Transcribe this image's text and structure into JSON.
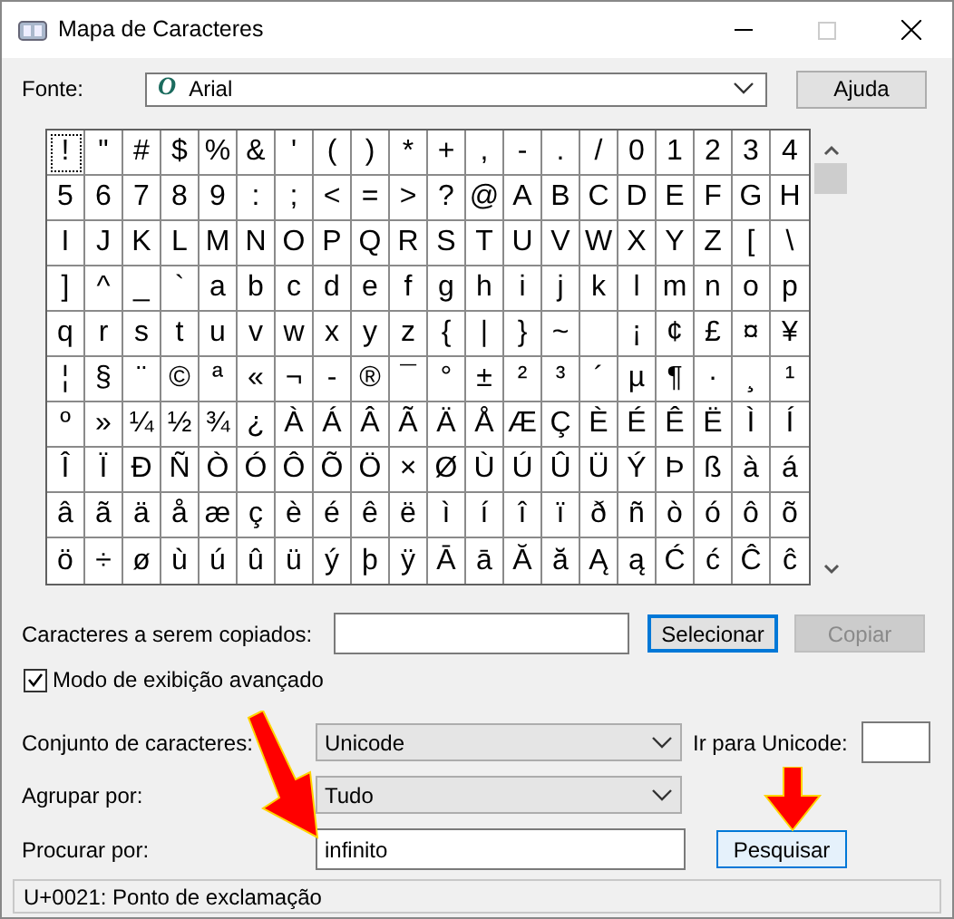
{
  "window": {
    "title": "Mapa de Caracteres"
  },
  "font": {
    "label": "Fonte:",
    "value": "Arial",
    "icon_glyph": "O"
  },
  "help_button": "Ajuda",
  "grid": [
    [
      {
        "char": "!",
        "selected": true
      },
      {
        "char": "\"",
        "selected": false
      },
      {
        "char": "#",
        "selected": false
      },
      {
        "char": "$",
        "selected": false
      },
      {
        "char": "%",
        "selected": false
      },
      {
        "char": "&",
        "selected": false
      },
      {
        "char": "'",
        "selected": false
      },
      {
        "char": "(",
        "selected": false
      },
      {
        "char": ")",
        "selected": false
      },
      {
        "char": "*",
        "selected": false
      },
      {
        "char": "+",
        "selected": false
      },
      {
        "char": ",",
        "selected": false
      },
      {
        "char": "-",
        "selected": false
      },
      {
        "char": ".",
        "selected": false
      },
      {
        "char": "/",
        "selected": false
      },
      {
        "char": "0",
        "selected": false
      },
      {
        "char": "1",
        "selected": false
      },
      {
        "char": "2",
        "selected": false
      },
      {
        "char": "3",
        "selected": false
      },
      {
        "char": "4",
        "selected": false
      }
    ],
    [
      {
        "char": "5",
        "selected": false
      },
      {
        "char": "6",
        "selected": false
      },
      {
        "char": "7",
        "selected": false
      },
      {
        "char": "8",
        "selected": false
      },
      {
        "char": "9",
        "selected": false
      },
      {
        "char": ":",
        "selected": false
      },
      {
        "char": ";",
        "selected": false
      },
      {
        "char": "<",
        "selected": false
      },
      {
        "char": "=",
        "selected": false
      },
      {
        "char": ">",
        "selected": false
      },
      {
        "char": "?",
        "selected": false
      },
      {
        "char": "@",
        "selected": false
      },
      {
        "char": "A",
        "selected": false
      },
      {
        "char": "B",
        "selected": false
      },
      {
        "char": "C",
        "selected": false
      },
      {
        "char": "D",
        "selected": false
      },
      {
        "char": "E",
        "selected": false
      },
      {
        "char": "F",
        "selected": false
      },
      {
        "char": "G",
        "selected": false
      },
      {
        "char": "H",
        "selected": false
      }
    ],
    [
      {
        "char": "I",
        "selected": false
      },
      {
        "char": "J",
        "selected": false
      },
      {
        "char": "K",
        "selected": false
      },
      {
        "char": "L",
        "selected": false
      },
      {
        "char": "M",
        "selected": false
      },
      {
        "char": "N",
        "selected": false
      },
      {
        "char": "O",
        "selected": false
      },
      {
        "char": "P",
        "selected": false
      },
      {
        "char": "Q",
        "selected": false
      },
      {
        "char": "R",
        "selected": false
      },
      {
        "char": "S",
        "selected": false
      },
      {
        "char": "T",
        "selected": false
      },
      {
        "char": "U",
        "selected": false
      },
      {
        "char": "V",
        "selected": false
      },
      {
        "char": "W",
        "selected": false
      },
      {
        "char": "X",
        "selected": false
      },
      {
        "char": "Y",
        "selected": false
      },
      {
        "char": "Z",
        "selected": false
      },
      {
        "char": "[",
        "selected": false
      },
      {
        "char": "\\",
        "selected": false
      }
    ],
    [
      {
        "char": "]",
        "selected": false
      },
      {
        "char": "^",
        "selected": false
      },
      {
        "char": "_",
        "selected": false
      },
      {
        "char": "`",
        "selected": false
      },
      {
        "char": "a",
        "selected": false
      },
      {
        "char": "b",
        "selected": false
      },
      {
        "char": "c",
        "selected": false
      },
      {
        "char": "d",
        "selected": false
      },
      {
        "char": "e",
        "selected": false
      },
      {
        "char": "f",
        "selected": false
      },
      {
        "char": "g",
        "selected": false
      },
      {
        "char": "h",
        "selected": false
      },
      {
        "char": "i",
        "selected": false
      },
      {
        "char": "j",
        "selected": false
      },
      {
        "char": "k",
        "selected": false
      },
      {
        "char": "l",
        "selected": false
      },
      {
        "char": "m",
        "selected": false
      },
      {
        "char": "n",
        "selected": false
      },
      {
        "char": "o",
        "selected": false
      },
      {
        "char": "p",
        "selected": false
      }
    ],
    [
      {
        "char": "q",
        "selected": false
      },
      {
        "char": "r",
        "selected": false
      },
      {
        "char": "s",
        "selected": false
      },
      {
        "char": "t",
        "selected": false
      },
      {
        "char": "u",
        "selected": false
      },
      {
        "char": "v",
        "selected": false
      },
      {
        "char": "w",
        "selected": false
      },
      {
        "char": "x",
        "selected": false
      },
      {
        "char": "y",
        "selected": false
      },
      {
        "char": "z",
        "selected": false
      },
      {
        "char": "{",
        "selected": false
      },
      {
        "char": "|",
        "selected": false
      },
      {
        "char": "}",
        "selected": false
      },
      {
        "char": "~",
        "selected": false
      },
      {
        "selected": false
      },
      {
        "char": "¡",
        "selected": false
      },
      {
        "char": "¢",
        "selected": false
      },
      {
        "char": "£",
        "selected": false
      },
      {
        "char": "¤",
        "selected": false
      },
      {
        "char": "¥",
        "selected": false
      }
    ],
    [
      {
        "char": "¦",
        "selected": false
      },
      {
        "char": "§",
        "selected": false
      },
      {
        "char": "¨",
        "selected": false
      },
      {
        "char": "©",
        "selected": false
      },
      {
        "char": "ª",
        "selected": false
      },
      {
        "char": "«",
        "selected": false
      },
      {
        "char": "¬",
        "selected": false
      },
      {
        "char": "-",
        "selected": false
      },
      {
        "char": "®",
        "selected": false
      },
      {
        "char": "¯",
        "selected": false
      },
      {
        "char": "°",
        "selected": false
      },
      {
        "char": "±",
        "selected": false
      },
      {
        "char": "²",
        "selected": false
      },
      {
        "char": "³",
        "selected": false
      },
      {
        "char": "´",
        "selected": false
      },
      {
        "char": "µ",
        "selected": false
      },
      {
        "char": "¶",
        "selected": false
      },
      {
        "char": "·",
        "selected": false
      },
      {
        "char": "¸",
        "selected": false
      },
      {
        "char": "¹",
        "selected": false
      }
    ],
    [
      {
        "char": "º",
        "selected": false
      },
      {
        "char": "»",
        "selected": false
      },
      {
        "char": "¼",
        "selected": false
      },
      {
        "char": "½",
        "selected": false
      },
      {
        "char": "¾",
        "selected": false
      },
      {
        "char": "¿",
        "selected": false
      },
      {
        "char": "À",
        "selected": false
      },
      {
        "char": "Á",
        "selected": false
      },
      {
        "char": "Â",
        "selected": false
      },
      {
        "char": "Ã",
        "selected": false
      },
      {
        "char": "Ä",
        "selected": false
      },
      {
        "char": "Å",
        "selected": false
      },
      {
        "char": "Æ",
        "selected": false
      },
      {
        "char": "Ç",
        "selected": false
      },
      {
        "char": "È",
        "selected": false
      },
      {
        "char": "É",
        "selected": false
      },
      {
        "char": "Ê",
        "selected": false
      },
      {
        "char": "Ë",
        "selected": false
      },
      {
        "char": "Ì",
        "selected": false
      },
      {
        "char": "Í",
        "selected": false
      }
    ],
    [
      {
        "char": "Î",
        "selected": false
      },
      {
        "char": "Ï",
        "selected": false
      },
      {
        "char": "Ð",
        "selected": false
      },
      {
        "char": "Ñ",
        "selected": false
      },
      {
        "char": "Ò",
        "selected": false
      },
      {
        "char": "Ó",
        "selected": false
      },
      {
        "char": "Ô",
        "selected": false
      },
      {
        "char": "Õ",
        "selected": false
      },
      {
        "char": "Ö",
        "selected": false
      },
      {
        "char": "×",
        "selected": false
      },
      {
        "char": "Ø",
        "selected": false
      },
      {
        "char": "Ù",
        "selected": false
      },
      {
        "char": "Ú",
        "selected": false
      },
      {
        "char": "Û",
        "selected": false
      },
      {
        "char": "Ü",
        "selected": false
      },
      {
        "char": "Ý",
        "selected": false
      },
      {
        "char": "Þ",
        "selected": false
      },
      {
        "char": "ß",
        "selected": false
      },
      {
        "char": "à",
        "selected": false
      },
      {
        "char": "á",
        "selected": false
      }
    ],
    [
      {
        "char": "â",
        "selected": false
      },
      {
        "char": "ã",
        "selected": false
      },
      {
        "char": "ä",
        "selected": false
      },
      {
        "char": "å",
        "selected": false
      },
      {
        "char": "æ",
        "selected": false
      },
      {
        "char": "ç",
        "selected": false
      },
      {
        "char": "è",
        "selected": false
      },
      {
        "char": "é",
        "selected": false
      },
      {
        "char": "ê",
        "selected": false
      },
      {
        "char": "ë",
        "selected": false
      },
      {
        "char": "ì",
        "selected": false
      },
      {
        "char": "í",
        "selected": false
      },
      {
        "char": "î",
        "selected": false
      },
      {
        "char": "ï",
        "selected": false
      },
      {
        "char": "ð",
        "selected": false
      },
      {
        "char": "ñ",
        "selected": false
      },
      {
        "char": "ò",
        "selected": false
      },
      {
        "char": "ó",
        "selected": false
      },
      {
        "char": "ô",
        "selected": false
      },
      {
        "char": "õ",
        "selected": false
      }
    ],
    [
      {
        "char": "ö",
        "selected": false
      },
      {
        "char": "÷",
        "selected": false
      },
      {
        "char": "ø",
        "selected": false
      },
      {
        "char": "ù",
        "selected": false
      },
      {
        "char": "ú",
        "selected": false
      },
      {
        "char": "û",
        "selected": false
      },
      {
        "char": "ü",
        "selected": false
      },
      {
        "char": "ý",
        "selected": false
      },
      {
        "char": "þ",
        "selected": false
      },
      {
        "char": "ÿ",
        "selected": false
      },
      {
        "char": "Ā",
        "selected": false
      },
      {
        "char": "ā",
        "selected": false
      },
      {
        "char": "Ă",
        "selected": false
      },
      {
        "char": "ă",
        "selected": false
      },
      {
        "char": "Ą",
        "selected": false
      },
      {
        "char": "ą",
        "selected": false
      },
      {
        "char": "Ć",
        "selected": false
      },
      {
        "char": "ć",
        "selected": false
      },
      {
        "char": "Ĉ",
        "selected": false
      },
      {
        "char": "ĉ",
        "selected": false
      }
    ]
  ],
  "copy": {
    "label": "Caracteres a serem copiados:",
    "select_button": "Selecionar",
    "copy_button": "Copiar",
    "copy_disabled": true
  },
  "advanced": {
    "label": "Modo de exibição avançado",
    "checked": true
  },
  "charset": {
    "label": "Conjunto de caracteres:",
    "value": "Unicode"
  },
  "goto_unicode": {
    "label": "Ir para Unicode:"
  },
  "group_by": {
    "label": "Agrupar por:",
    "value": "Tudo"
  },
  "search": {
    "label": "Procurar por:",
    "value": "infinito",
    "button": "Pesquisar"
  },
  "status_bar": "U+0021: Ponto de exclamação"
}
